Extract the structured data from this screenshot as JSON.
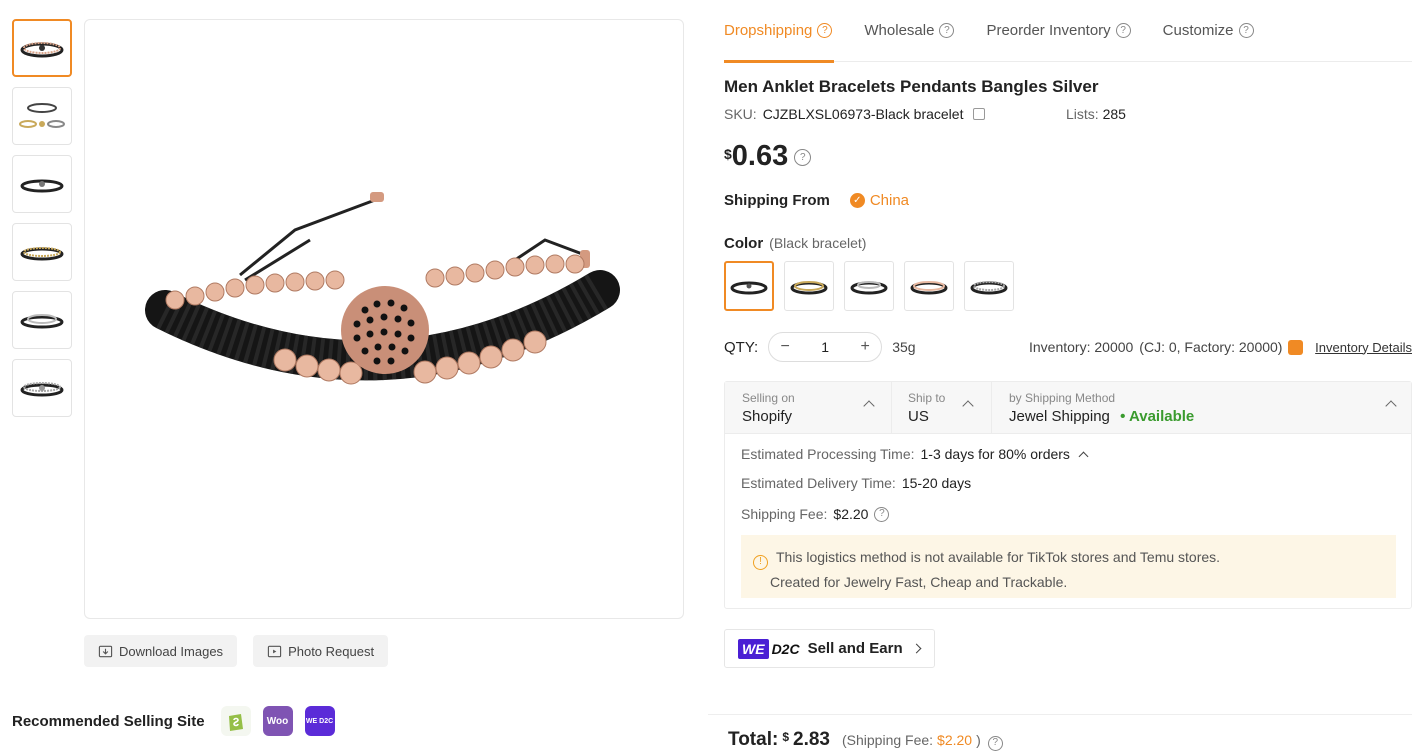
{
  "thumbnails": [
    {
      "name": "thumb-1",
      "active": true
    },
    {
      "name": "thumb-2",
      "active": false
    },
    {
      "name": "thumb-3",
      "active": false
    },
    {
      "name": "thumb-4",
      "active": false
    },
    {
      "name": "thumb-5",
      "active": false
    },
    {
      "name": "thumb-6",
      "active": false
    }
  ],
  "image_actions": {
    "download_label": "Download Images",
    "photo_request_label": "Photo Request"
  },
  "recommended": {
    "label": "Recommended Selling Site",
    "sites": [
      "shopify-icon",
      "woocommerce-icon",
      "wed2c-icon"
    ]
  },
  "tabs": [
    {
      "label": "Dropshipping",
      "active": true
    },
    {
      "label": "Wholesale",
      "active": false
    },
    {
      "label": "Preorder Inventory",
      "active": false
    },
    {
      "label": "Customize",
      "active": false
    }
  ],
  "product": {
    "title": "Men Anklet Bracelets Pendants Bangles Silver",
    "sku_label": "SKU:",
    "sku": "CJZBLXSL06973-Black bracelet",
    "lists_label": "Lists:",
    "lists": "285",
    "currency": "$",
    "price": "0.63",
    "shipping_from_label": "Shipping From",
    "shipping_from": "China",
    "color_label": "Color",
    "color_selected": "(Black bracelet)",
    "swatch_count": 5,
    "qty_label": "QTY:",
    "qty": "1",
    "weight": "35g",
    "inventory": "Inventory: 20000",
    "inventory_breakdown": "(CJ: 0, Factory: 20000)",
    "inventory_link": "Inventory Details"
  },
  "shipping": {
    "selling_on_label": "Selling on",
    "selling_on": "Shopify",
    "ship_to_label": "Ship to",
    "ship_to": "US",
    "method_label": "by Shipping Method",
    "method": "Jewel Shipping",
    "availability": "Available",
    "processing_label": "Estimated Processing Time:",
    "processing": "1-3 days for 80% orders",
    "delivery_label": "Estimated Delivery Time:",
    "delivery": "15-20 days",
    "fee_label": "Shipping Fee:",
    "fee": "$2.20",
    "notice_line1": "This logistics method is not available for TikTok stores and Temu stores.",
    "notice_line2": "Created for Jewelry Fast, Cheap and Trackable."
  },
  "d2c": {
    "we": "WE",
    "d2c": "D2C",
    "label": "Sell and Earn"
  },
  "total": {
    "label": "Total:",
    "currency": "$",
    "amount": "2.83",
    "fee_prefix": "(Shipping Fee:",
    "fee": "$2.20",
    "fee_suffix": ")"
  },
  "colors": {
    "accent": "#f08a24",
    "available": "#3a9b2e"
  }
}
